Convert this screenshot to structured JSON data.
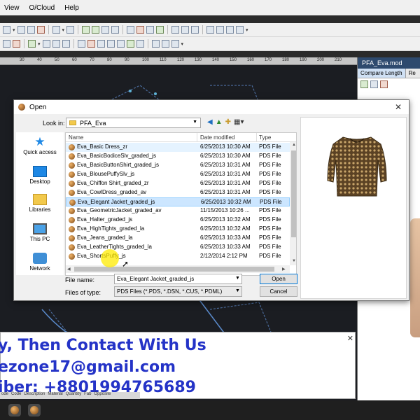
{
  "menubar": {
    "items": [
      "View",
      "O/Cloud",
      "Help"
    ]
  },
  "ruler": {
    "ticks": [
      "30",
      "40",
      "50",
      "60",
      "70",
      "80",
      "90",
      "100",
      "110",
      "120",
      "130",
      "140",
      "150",
      "160",
      "170",
      "180",
      "190",
      "200",
      "210"
    ]
  },
  "right_panel": {
    "title": "PFA_Eva.mod",
    "tabs": [
      "Compare Length",
      "Re"
    ]
  },
  "dialog": {
    "title": "Open",
    "close_glyph": "✕",
    "look_in_label": "Look in:",
    "look_in_value": "PFA_Eva",
    "places": [
      "Quick access",
      "Desktop",
      "Libraries",
      "This PC",
      "Network"
    ],
    "columns": {
      "name": "Name",
      "date": "Date modified",
      "type": "Type"
    },
    "files": [
      {
        "name": "Eva_Basic Dress_zr",
        "date": "6/25/2013 10:30 AM",
        "type": "PDS File"
      },
      {
        "name": "Eva_BasicBodiceSlv_graded_js",
        "date": "6/25/2013 10:30 AM",
        "type": "PDS File"
      },
      {
        "name": "Eva_BasicButtonShirt_graded_js",
        "date": "6/25/2013 10:31 AM",
        "type": "PDS File"
      },
      {
        "name": "Eva_BlousePuffySlv_js",
        "date": "6/25/2013 10:31 AM",
        "type": "PDS File"
      },
      {
        "name": "Eva_Chiffon Shirt_graded_zr",
        "date": "6/25/2013 10:31 AM",
        "type": "PDS File"
      },
      {
        "name": "Eva_CowlDress_graded_av",
        "date": "6/25/2013 10:31 AM",
        "type": "PDS File"
      },
      {
        "name": "Eva_Elegant Jacket_graded_js",
        "date": "6/25/2013 10:32 AM",
        "type": "PDS File"
      },
      {
        "name": "Eva_GeometricJacket_graded_av",
        "date": "11/15/2013 10:26 ...",
        "type": "PDS File"
      },
      {
        "name": "Eva_Halter_graded_js",
        "date": "6/25/2013 10:32 AM",
        "type": "PDS File"
      },
      {
        "name": "Eva_HighTights_graded_la",
        "date": "6/25/2013 10:32 AM",
        "type": "PDS File"
      },
      {
        "name": "Eva_Jeans_graded_la",
        "date": "6/25/2013 10:33 AM",
        "type": "PDS File"
      },
      {
        "name": "Eva_LeatherTights_graded_la",
        "date": "6/25/2013 10:33 AM",
        "type": "PDS File"
      },
      {
        "name": "Eva_ShortsPuffy_js",
        "date": "2/12/2014 2:12 PM",
        "type": "PDS File"
      }
    ],
    "file_name_label": "File name:",
    "file_name_value": "Eva_Elegant Jacket_graded_js",
    "file_type_label": "Files of type:",
    "file_type_value": "PDS Files (*.PDS, *.DSN, *.CUS, *.PDML)",
    "open_label": "Open",
    "cancel_label": "Cancel"
  },
  "banner": {
    "line1": "y, Then Contact With Us",
    "line2": "ezone17@gmail.com",
    "line3": "iber:  +8801994765689",
    "close_glyph": "✕",
    "color": "#2433c7"
  },
  "bottom_tabs": [
    "ode",
    "Code",
    "Description",
    "Material",
    "Quantity",
    "Fab",
    "Opposite"
  ],
  "colors": {
    "selection": "#cce6ff",
    "accent": "#0078d7",
    "canvas": "#1b1d22"
  }
}
